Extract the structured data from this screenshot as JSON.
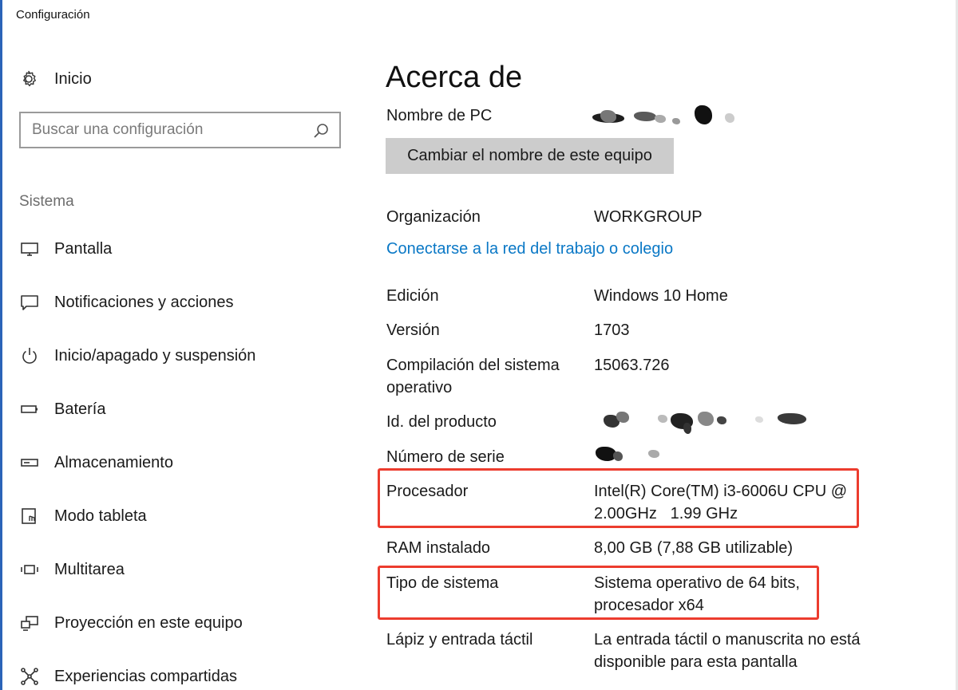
{
  "window": {
    "title": "Configuración"
  },
  "sidebar": {
    "home_label": "Inicio",
    "search_placeholder": "Buscar una configuración",
    "section_label": "Sistema",
    "items": [
      {
        "label": "Pantalla",
        "icon": "monitor-icon"
      },
      {
        "label": "Notificaciones y acciones",
        "icon": "notification-icon"
      },
      {
        "label": "Inicio/apagado y suspensión",
        "icon": "power-icon"
      },
      {
        "label": "Batería",
        "icon": "battery-icon"
      },
      {
        "label": "Almacenamiento",
        "icon": "storage-icon"
      },
      {
        "label": "Modo tableta",
        "icon": "tablet-mode-icon"
      },
      {
        "label": "Multitarea",
        "icon": "multitask-icon"
      },
      {
        "label": "Proyección en este equipo",
        "icon": "projection-icon"
      },
      {
        "label": "Experiencias compartidas",
        "icon": "shared-experiences-icon"
      }
    ]
  },
  "main": {
    "title": "Acerca de",
    "pc_name_label": "Nombre de PC",
    "rename_button": "Cambiar el nombre de este equipo",
    "organization_label": "Organización",
    "organization_value": "WORKGROUP",
    "connect_link": "Conectarse a la red del trabajo o colegio",
    "edition_label": "Edición",
    "edition_value": "Windows 10 Home",
    "version_label": "Versión",
    "version_value": "1703",
    "build_label": "Compilación del sistema operativo",
    "build_value": "15063.726",
    "product_id_label": "Id. del producto",
    "serial_label": "Número de serie",
    "processor_label": "Procesador",
    "processor_value": "Intel(R) Core(TM) i3-6006U CPU @ 2.00GHz   1.99 GHz",
    "ram_label": "RAM instalado",
    "ram_value": "8,00 GB (7,88 GB utilizable)",
    "system_type_label": "Tipo de sistema",
    "system_type_value": "Sistema operativo de 64 bits, procesador x64",
    "pen_label": "Lápiz y entrada táctil",
    "pen_value": "La entrada táctil o manuscrita no está disponible para esta pantalla"
  },
  "colors": {
    "accent_link": "#0a78c6",
    "highlight_border": "#ec3c2e",
    "button_bg": "#cccccc"
  }
}
